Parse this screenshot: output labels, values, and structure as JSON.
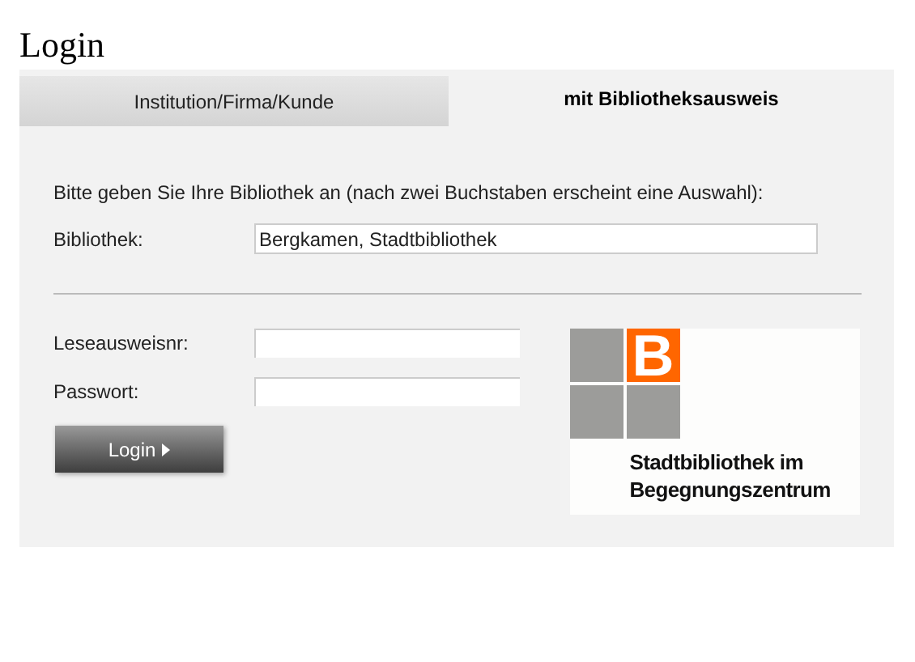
{
  "title": "Login",
  "tabs": [
    {
      "label": "Institution/Firma/Kunde",
      "selected": false
    },
    {
      "label": "mit Bibliotheksausweis",
      "selected": true
    }
  ],
  "instruction": "Bitte geben Sie Ihre Bibliothek an (nach zwei Buchstaben erscheint eine Auswahl):",
  "library_field": {
    "label": "Bibliothek:",
    "value": "Bergkamen, Stadtbibliothek"
  },
  "card_fields": [
    {
      "label": "Leseausweisnr:"
    },
    {
      "label": "Passwort:"
    }
  ],
  "login_button": "Login",
  "logo": {
    "letter": "B",
    "lines": [
      "Stadtbibliothek im",
      "Begegnungszentrum"
    ]
  }
}
